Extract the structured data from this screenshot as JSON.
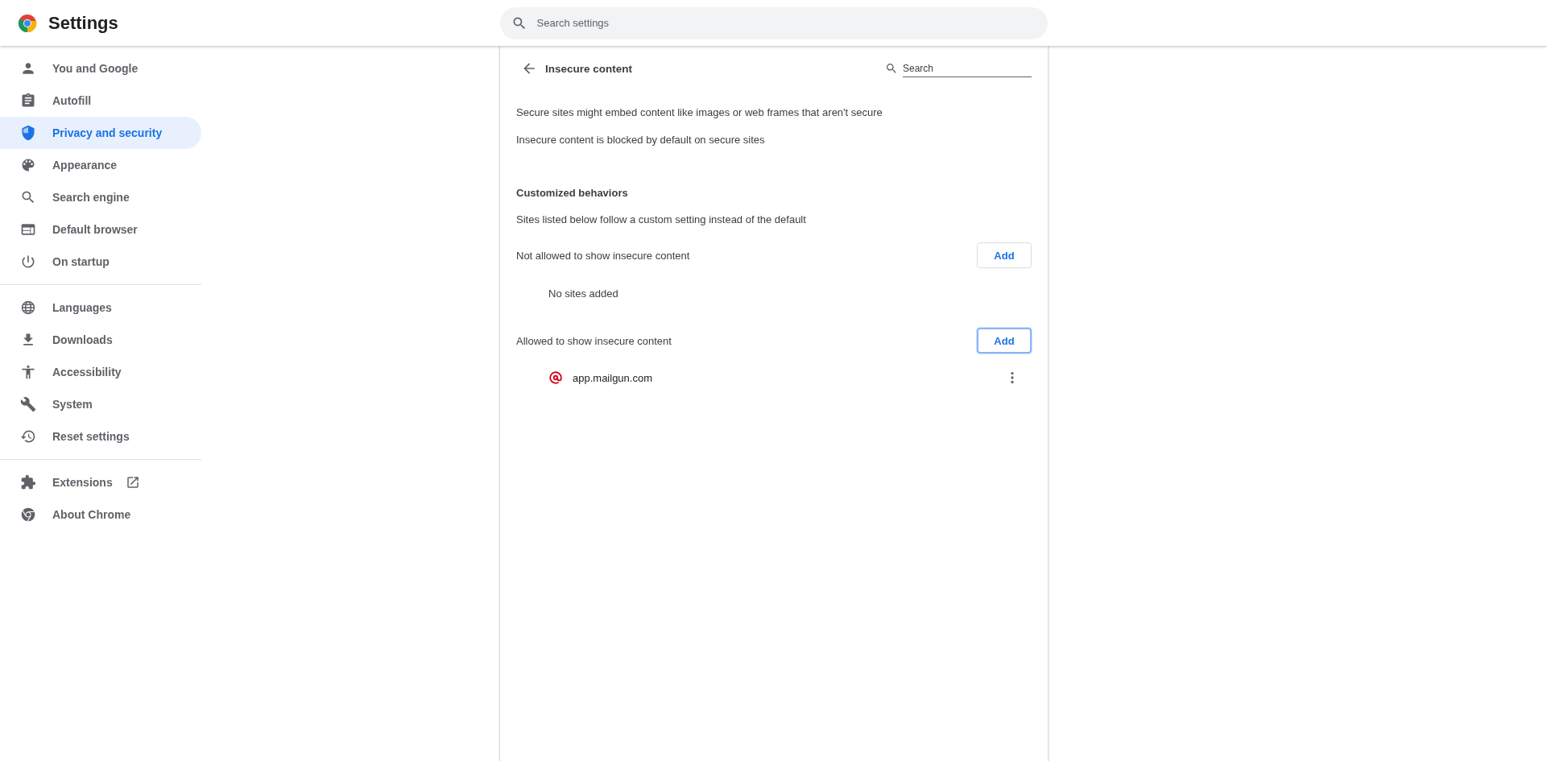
{
  "header": {
    "title": "Settings",
    "search": {
      "placeholder": "Search settings"
    }
  },
  "sidebar": {
    "groups": [
      {
        "items": [
          {
            "label": "You and Google",
            "selected": false,
            "external_link": false
          },
          {
            "label": "Autofill",
            "selected": false,
            "external_link": false
          },
          {
            "label": "Privacy and security",
            "selected": true,
            "external_link": false
          },
          {
            "label": "Appearance",
            "selected": false,
            "external_link": false
          },
          {
            "label": "Search engine",
            "selected": false,
            "external_link": false
          },
          {
            "label": "Default browser",
            "selected": false,
            "external_link": false
          },
          {
            "label": "On startup",
            "selected": false,
            "external_link": false
          }
        ]
      },
      {
        "items": [
          {
            "label": "Languages",
            "selected": false,
            "external_link": false
          },
          {
            "label": "Downloads",
            "selected": false,
            "external_link": false
          },
          {
            "label": "Accessibility",
            "selected": false,
            "external_link": false
          },
          {
            "label": "System",
            "selected": false,
            "external_link": false
          },
          {
            "label": "Reset settings",
            "selected": false,
            "external_link": false
          }
        ]
      },
      {
        "items": [
          {
            "label": "Extensions",
            "selected": false,
            "external_link": true
          },
          {
            "label": "About Chrome",
            "selected": false,
            "external_link": false
          }
        ]
      }
    ]
  },
  "page": {
    "title": "Insecure content",
    "search": {
      "placeholder": "Search"
    },
    "descriptions": [
      "Secure sites might embed content like images or web frames that aren't secure",
      "Insecure content is blocked by default on secure sites"
    ],
    "section_title": "Customized behaviors",
    "section_description": "Sites listed below follow a custom setting instead of the default",
    "lists": [
      {
        "label": "Not allowed to show insecure content",
        "button": {
          "label": "Add",
          "focused": false
        },
        "empty_text": "No sites added"
      },
      {
        "label": "Allowed to show insecure content",
        "button": {
          "label": "Add",
          "focused": true
        },
        "sites": [
          {
            "name": "app.mailgun.com"
          }
        ]
      }
    ]
  }
}
